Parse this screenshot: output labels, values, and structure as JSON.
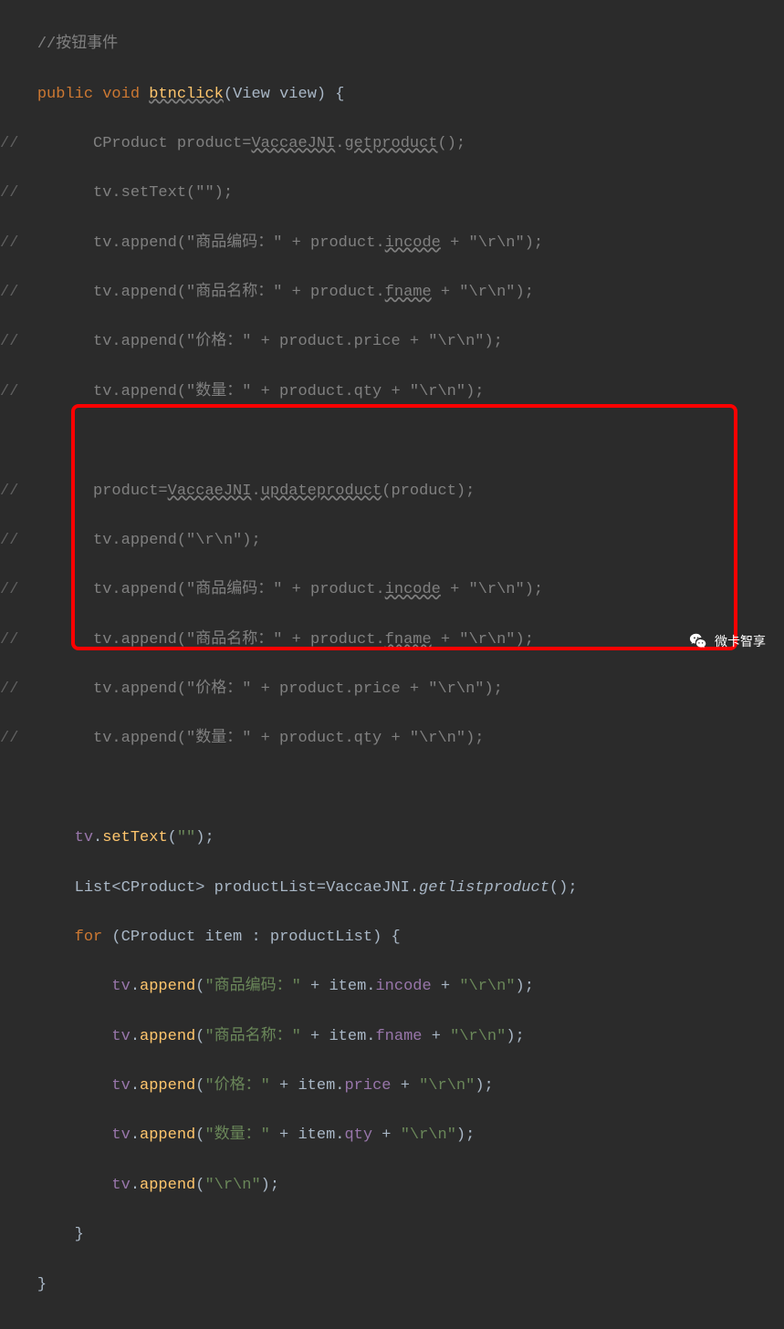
{
  "code": {
    "comment_header": "//按钮事件",
    "line1_public": "public",
    "line1_void": "void",
    "line1_method": "btnclick",
    "line1_paren_open": "(View view) {",
    "commented_lines": {
      "cl1_prefix": "//",
      "cl1_text1": "        CProduct product=",
      "cl1_class": "VaccaeJNI",
      "cl1_dot": ".",
      "cl1_method": "getproduct",
      "cl1_end": "();",
      "cl2_prefix": "//",
      "cl2_text": "        tv.setText(\"\");",
      "cl3_prefix": "//",
      "cl3_text1": "        tv.append(\"商品编码：\" + product.",
      "cl3_field": "incode",
      "cl3_text2": " + \"\\r\\n\");",
      "cl4_prefix": "//",
      "cl4_text1": "        tv.append(\"商品名称：\" + product.",
      "cl4_field": "fname",
      "cl4_text2": " + \"\\r\\n\");",
      "cl5_prefix": "//",
      "cl5_text": "        tv.append(\"价格：\" + product.price + \"\\r\\n\");",
      "cl6_prefix": "//",
      "cl6_text": "        tv.append(\"数量：\" + product.qty + \"\\r\\n\");",
      "cl7_prefix": "//",
      "cl7_text1": "        product=",
      "cl7_class": "VaccaeJNI",
      "cl7_dot": ".",
      "cl7_method": "updateproduct",
      "cl7_end": "(product);",
      "cl8_prefix": "//",
      "cl8_text": "        tv.append(\"\\r\\n\");",
      "cl9_prefix": "//",
      "cl9_text1": "        tv.append(\"商品编码：\" + product.",
      "cl9_field": "incode",
      "cl9_text2": " + \"\\r\\n\");",
      "cl10_prefix": "//",
      "cl10_text1": "        tv.append(\"商品名称：\" + product.",
      "cl10_field": "fname",
      "cl10_text2": " + \"\\r\\n\");",
      "cl11_prefix": "//",
      "cl11_text": "        tv.append(\"价格：\" + product.price + \"\\r\\n\");",
      "cl12_prefix": "//",
      "cl12_text": "        tv.append(\"数量：\" + product.qty + \"\\r\\n\");"
    },
    "active": {
      "a1_tv": "tv",
      "a1_dot": ".",
      "a1_method": "setText",
      "a1_paren": "(",
      "a1_str": "\"\"",
      "a1_end": ");",
      "a2_type": "List<CProduct> productList=VaccaeJNI.",
      "a2_method": "getlistproduct",
      "a2_end": "();",
      "a3_for": "for",
      "a3_paren": " (CProduct item : productList) {",
      "a4_tv": "tv",
      "a4_method": "append",
      "a4_str1": "\"商品编码：\"",
      "a4_plus1": " + item.",
      "a4_field": "incode",
      "a4_plus2": " + ",
      "a4_str2": "\"\\r\\n\"",
      "a4_end": ");",
      "a5_tv": "tv",
      "a5_method": "append",
      "a5_str1": "\"商品名称：\"",
      "a5_plus1": " + item.",
      "a5_field": "fname",
      "a5_plus2": " + ",
      "a5_str2": "\"\\r\\n\"",
      "a5_end": ");",
      "a6_tv": "tv",
      "a6_method": "append",
      "a6_str1": "\"价格：\"",
      "a6_plus1": " + item.",
      "a6_field": "price",
      "a6_plus2": " + ",
      "a6_str2": "\"\\r\\n\"",
      "a6_end": ");",
      "a7_tv": "tv",
      "a7_method": "append",
      "a7_str1": "\"数量：\"",
      "a7_plus1": " + item.",
      "a7_field": "qty",
      "a7_plus2": " + ",
      "a7_str2": "\"\\r\\n\"",
      "a7_end": ");",
      "a8_tv": "tv",
      "a8_method": "append",
      "a8_str": "\"\\r\\n\"",
      "a8_end": ");",
      "a9_brace": "}",
      "a10_brace": "}"
    }
  },
  "watermark": "微卡智享"
}
